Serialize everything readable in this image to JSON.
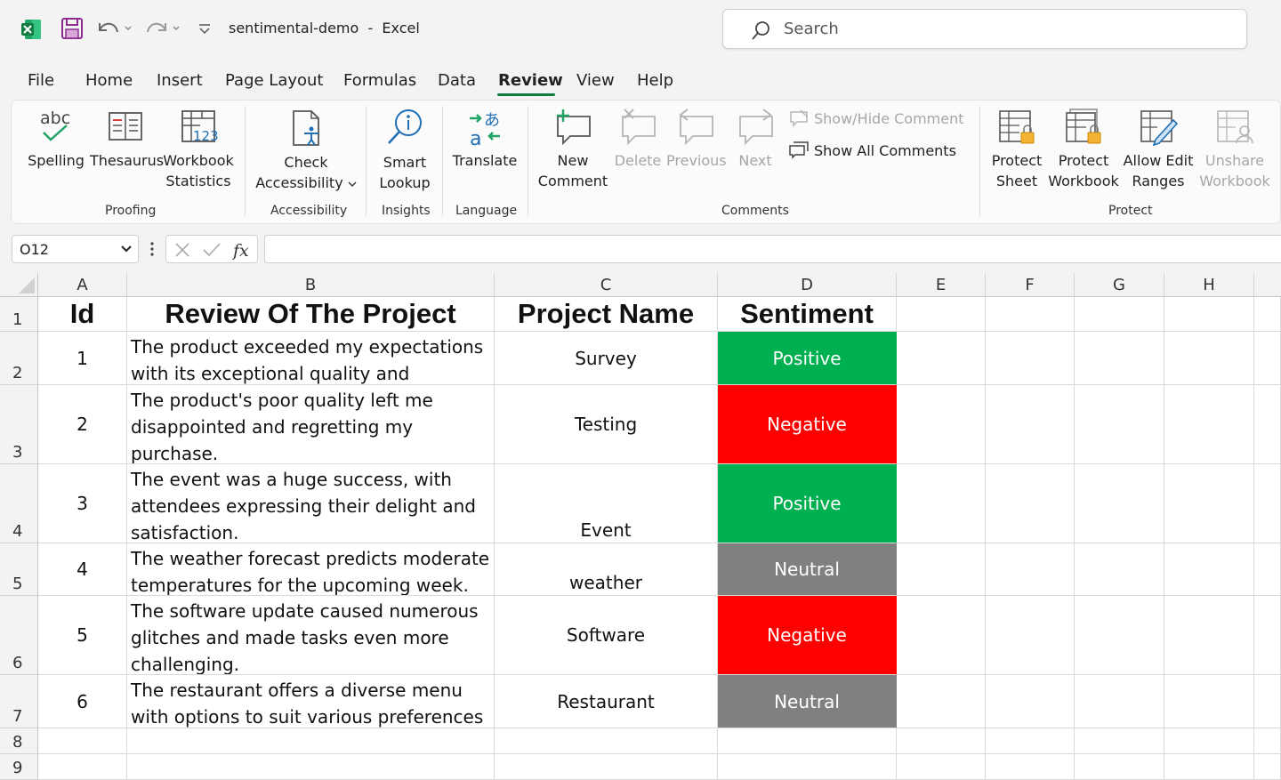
{
  "window": {
    "doc_name": "sentimental-demo",
    "app_name": "Excel",
    "search_placeholder": "Search"
  },
  "menu": {
    "tabs": [
      "File",
      "Home",
      "Insert",
      "Page Layout",
      "Formulas",
      "Data",
      "Review",
      "View",
      "Help"
    ],
    "active": "Review"
  },
  "ribbon": {
    "proofing": {
      "label": "Proofing",
      "spelling": "Spelling",
      "thesaurus": "Thesaurus",
      "workbook_stats_1": "Workbook",
      "workbook_stats_2": "Statistics",
      "abc": "abc"
    },
    "accessibility": {
      "label": "Accessibility",
      "check_1": "Check",
      "check_2": "Accessibility"
    },
    "insights": {
      "label": "Insights",
      "smart_1": "Smart",
      "smart_2": "Lookup"
    },
    "language": {
      "label": "Language",
      "translate": "Translate"
    },
    "comments": {
      "label": "Comments",
      "new_1": "New",
      "new_2": "Comment",
      "delete": "Delete",
      "previous": "Previous",
      "next": "Next",
      "show_hide": "Show/Hide Comment",
      "show_all": "Show All Comments"
    },
    "protect": {
      "label": "Protect",
      "sheet_1": "Protect",
      "sheet_2": "Sheet",
      "workbook_1": "Protect",
      "workbook_2": "Workbook",
      "allow_1": "Allow Edit",
      "allow_2": "Ranges",
      "unshare_1": "Unshare",
      "unshare_2": "Workbook"
    }
  },
  "formula_bar": {
    "name_box": "O12",
    "formula": ""
  },
  "columns": [
    "A",
    "B",
    "C",
    "D",
    "E",
    "F",
    "G",
    "H"
  ],
  "rows": [
    "1",
    "2",
    "3",
    "4",
    "5",
    "6",
    "7",
    "8",
    "9"
  ],
  "sheet": {
    "headers": {
      "id": "Id",
      "review": "Review Of The Project",
      "project": "Project Name",
      "sentiment": "Sentiment"
    },
    "records": [
      {
        "id": "1",
        "review": "The product exceeded my expectations with its exceptional quality and features.",
        "project": "Survey",
        "sentiment": "Positive"
      },
      {
        "id": "2",
        "review": "The product's poor quality left me disappointed and regretting my purchase.",
        "project": "Testing",
        "sentiment": "Negative"
      },
      {
        "id": "3",
        "review": "The event was a huge success, with attendees expressing their delight and satisfaction.",
        "project": "Event",
        "sentiment": "Positive"
      },
      {
        "id": "4",
        "review": "The weather forecast predicts moderate temperatures for the upcoming week.",
        "project": "weather",
        "sentiment": "Neutral"
      },
      {
        "id": "5",
        "review": "The software update caused numerous glitches and made tasks even more challenging.",
        "project": "Software",
        "sentiment": "Negative"
      },
      {
        "id": "6",
        "review": "The restaurant offers a diverse menu with options to suit various preferences",
        "project": "Restaurant",
        "sentiment": "Neutral"
      }
    ]
  },
  "colors": {
    "positive": "#00b050",
    "negative": "#ff0000",
    "neutral": "#808080",
    "accent": "#107c41"
  }
}
